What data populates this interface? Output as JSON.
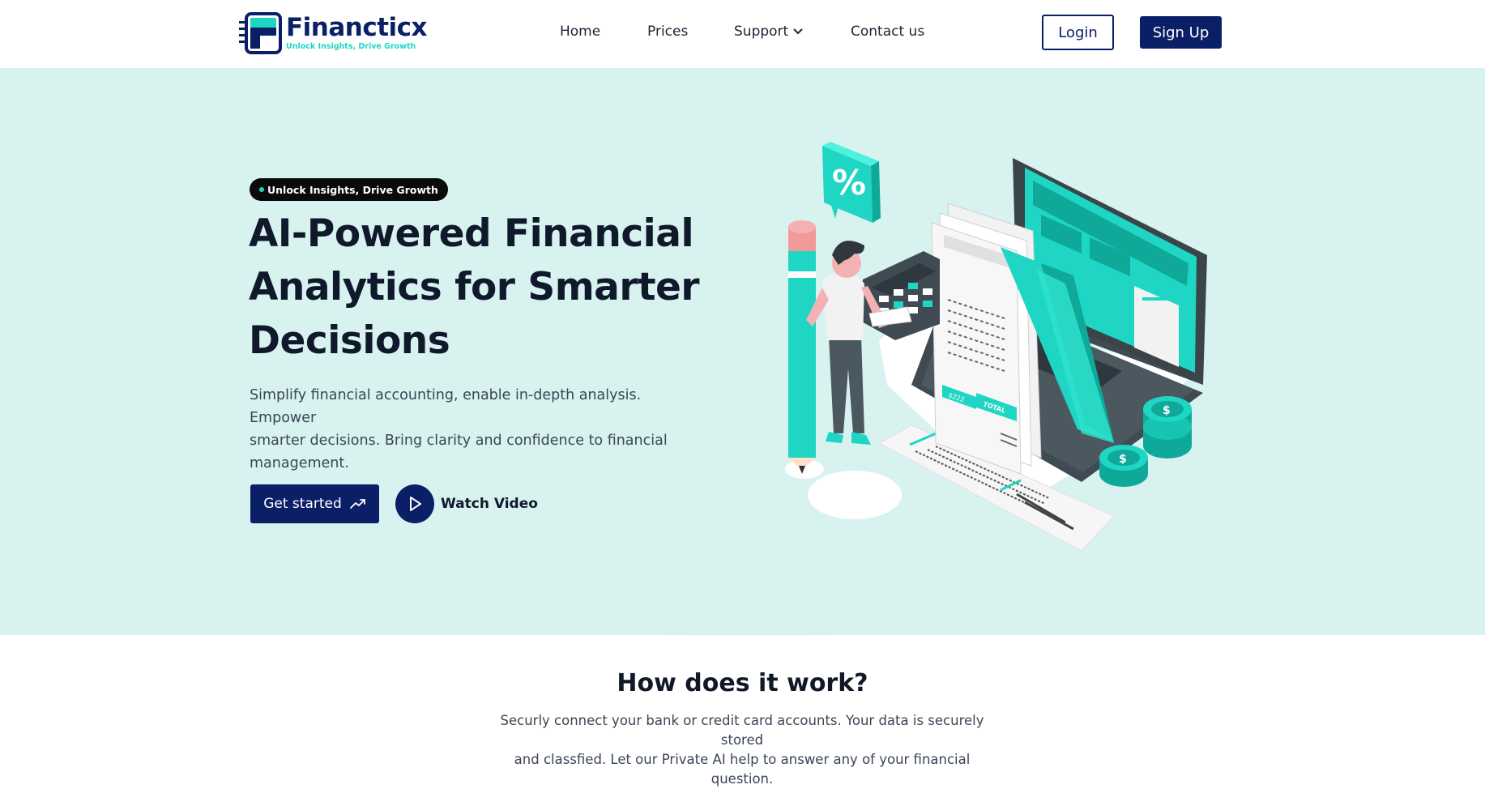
{
  "brand": {
    "name": "Financticx",
    "tagline": "Unlock Insights, Drive Growth"
  },
  "nav": {
    "items": [
      {
        "label": "Home"
      },
      {
        "label": "Prices"
      },
      {
        "label": "Support",
        "has_dropdown": true
      },
      {
        "label": "Contact us"
      }
    ],
    "login_label": "Login",
    "signup_label": "Sign Up"
  },
  "hero": {
    "badge": "Unlock Insights, Drive Growth",
    "title_lines": [
      "AI-Powered Financial",
      "Analytics for Smarter",
      "Decisions"
    ],
    "subtitle_lines": [
      "Simplify financial accounting, enable in-depth analysis. Empower",
      "smarter decisions. Bring clarity and confidence to financial",
      "management."
    ],
    "cta_primary": "Get started",
    "cta_secondary": "Watch Video",
    "illustration_texts": [
      "%",
      "$",
      "$",
      "TOTAL",
      "$222"
    ]
  },
  "how": {
    "title": "How does it work?",
    "subtitle_lines": [
      "Securly connect your bank or credit card accounts. Your data is securely stored",
      "and classfied. Let our Private AI help to answer any of your financial question."
    ]
  },
  "colors": {
    "brand_navy": "#0b1f66",
    "accent_teal": "#1ed6c3",
    "hero_bg": "#d8f2f0"
  },
  "icons": [
    "logo-mark",
    "chevron-down-icon",
    "trending-up-icon",
    "play-icon"
  ]
}
